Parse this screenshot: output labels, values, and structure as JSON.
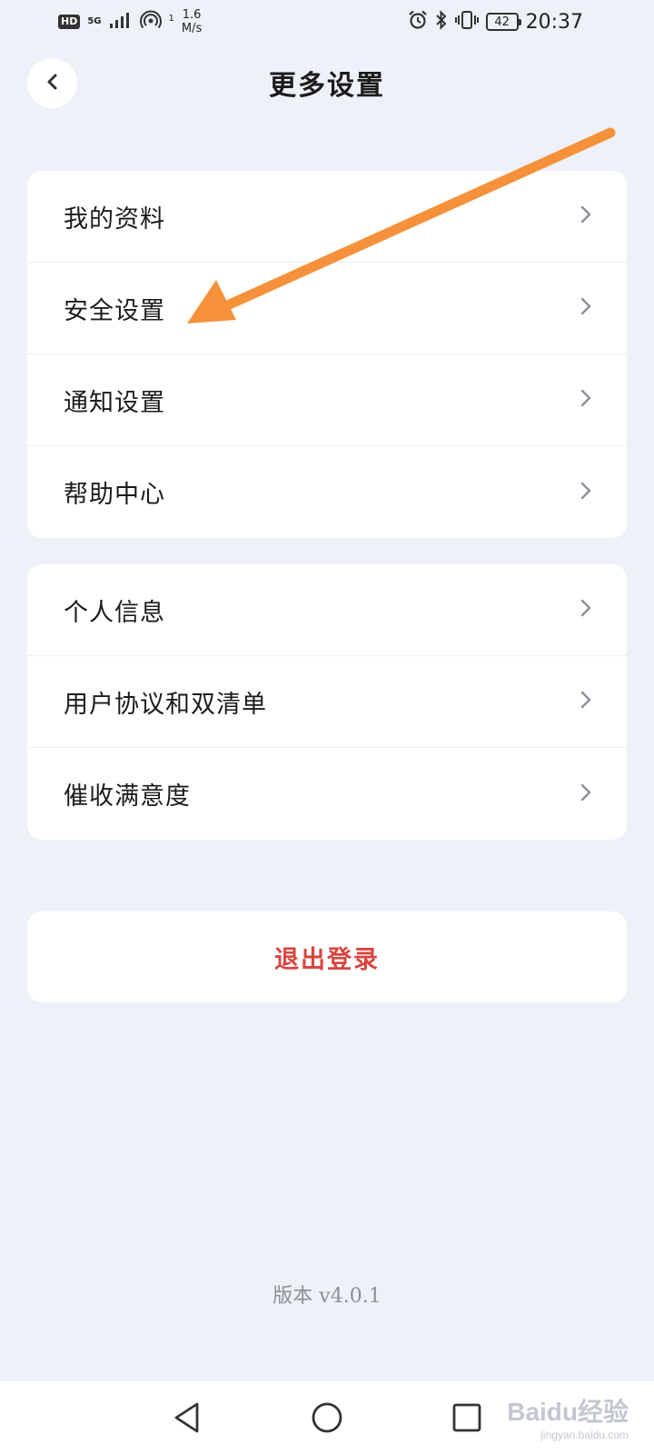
{
  "status_bar": {
    "hd": "HD",
    "network": "5G",
    "wifi_icon": "hotspot-icon",
    "wifi_count": "1",
    "speed_value": "1.6",
    "speed_unit": "M/s",
    "battery": "42",
    "time": "20:37"
  },
  "header": {
    "title": "更多设置",
    "back_icon": "chevron-left-icon"
  },
  "group1": {
    "items": [
      {
        "label": "我的资料"
      },
      {
        "label": "安全设置"
      },
      {
        "label": "通知设置"
      },
      {
        "label": "帮助中心"
      }
    ]
  },
  "group2": {
    "items": [
      {
        "label": "个人信息"
      },
      {
        "label": "用户协议和双清单"
      },
      {
        "label": "催收满意度"
      }
    ]
  },
  "logout": {
    "label": "退出登录"
  },
  "version": {
    "text": "版本 v4.0.1"
  },
  "colors": {
    "background": "#eef1f8",
    "card": "#ffffff",
    "logout_text": "#d9453f",
    "arrow": "#f5913a",
    "version_text": "#8a8f99"
  },
  "watermark": {
    "main": "Baidu经验",
    "sub": "jingyan.baidu.com"
  }
}
